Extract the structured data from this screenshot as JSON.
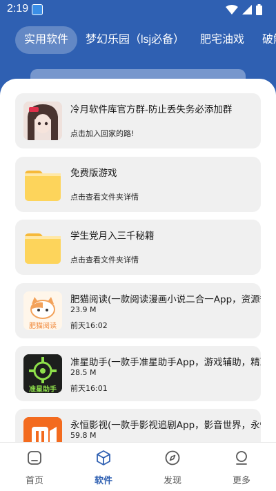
{
  "status": {
    "time": "2:19"
  },
  "tabs": [
    {
      "label": "实用软件"
    },
    {
      "label": "梦幻乐园（lsj必备）"
    },
    {
      "label": "肥宅油戏"
    },
    {
      "label": "破解"
    }
  ],
  "cards": [
    {
      "title": "冷月软件库官方群-防止丢失务必添加群",
      "line1": "点击加入回家的路!",
      "line2": "",
      "thumb": "anime-girl-avatar"
    },
    {
      "title": "免费版游戏",
      "line1": "点击查看文件夹详情",
      "line2": "",
      "thumb": "folder-icon"
    },
    {
      "title": "学生党月入三千秘籍",
      "line1": "点击查看文件夹详情",
      "line2": "",
      "thumb": "folder-icon"
    },
    {
      "title": "肥猫阅读(一款阅读漫画小说二合一App，资源*",
      "line1": "23.9 M",
      "line2": "前天16:02",
      "thumb": "fat-cat-reader-icon",
      "thumb_text": "肥猫阅读"
    },
    {
      "title": "准星助手(一款手准星助手App，游戏辅助，精准",
      "line1": "28.5 M",
      "line2": "前天16:01",
      "thumb": "crosshair-assistant-icon",
      "thumb_text": "准星助手"
    },
    {
      "title": "永恒影视(一款手影视追剧App，影音世界，永恒",
      "line1": "59.8 M",
      "line2": "",
      "thumb": "video-app-icon"
    }
  ],
  "nav": [
    {
      "label": "首页",
      "icon": "home-icon"
    },
    {
      "label": "软件",
      "icon": "cube-icon"
    },
    {
      "label": "发现",
      "icon": "compass-icon"
    },
    {
      "label": "更多",
      "icon": "profile-icon"
    }
  ],
  "colors": {
    "primary": "#2f60b2",
    "card_bg": "#f0f0f0",
    "folder": "#fdd45b"
  }
}
